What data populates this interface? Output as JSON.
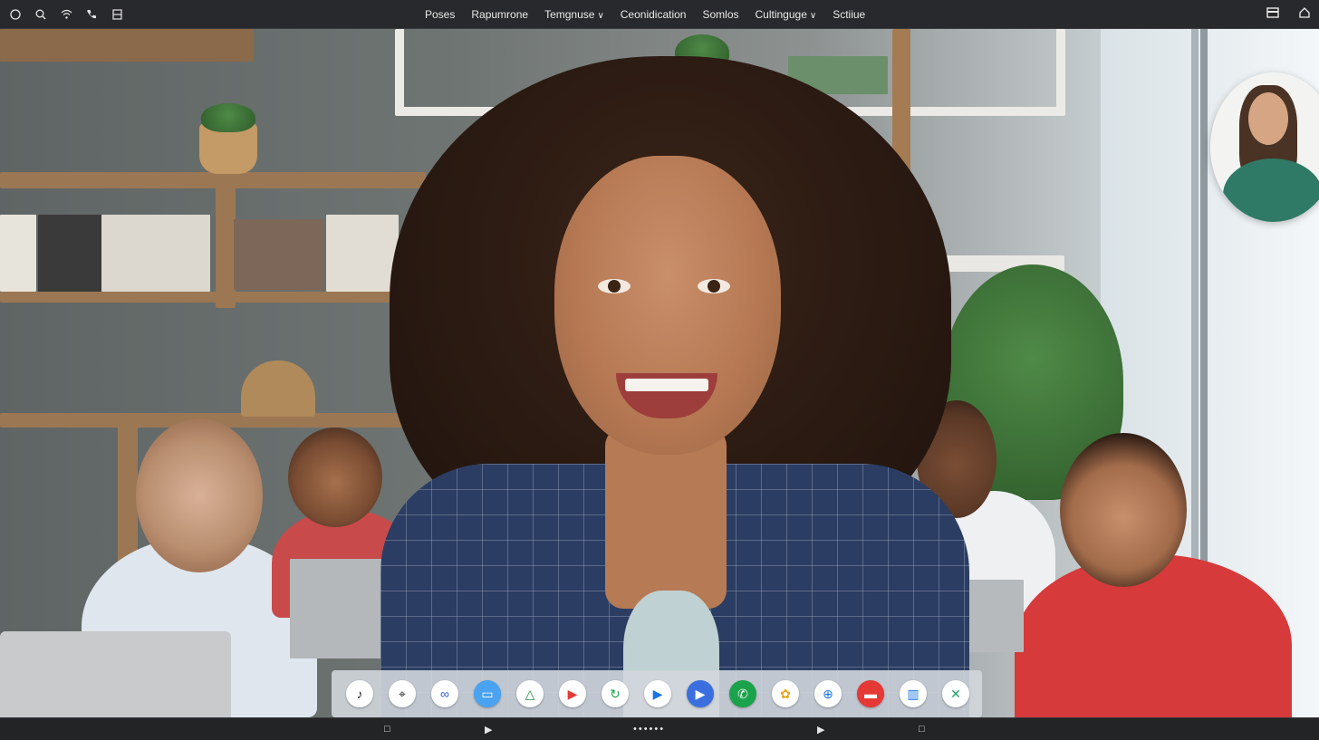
{
  "top_bar": {
    "left_icons": [
      "circle-icon",
      "search-icon",
      "wifi-icon",
      "phone-icon",
      "grid-icon"
    ],
    "menu": [
      {
        "label": "Poses",
        "dropdown": false
      },
      {
        "label": "Rapumrone",
        "dropdown": false
      },
      {
        "label": "Temgnuse",
        "dropdown": true
      },
      {
        "label": "Ceonidication",
        "dropdown": false
      },
      {
        "label": "Somlos",
        "dropdown": false
      },
      {
        "label": "Cultinguge",
        "dropdown": true
      },
      {
        "label": "Sctiiue",
        "dropdown": false
      }
    ],
    "right_icons": [
      "window-icon",
      "home-icon"
    ]
  },
  "dock": {
    "apps": [
      {
        "icon": "music-icon",
        "glyph": "♪",
        "bg": "#ffffff",
        "fg": "#222222"
      },
      {
        "icon": "maps-icon",
        "glyph": "⌖",
        "bg": "#ffffff",
        "fg": "#222222"
      },
      {
        "icon": "meta-icon",
        "glyph": "∞",
        "bg": "#ffffff",
        "fg": "#2a5bd7"
      },
      {
        "icon": "cast-icon",
        "glyph": "▭",
        "bg": "#4aa3f0",
        "fg": "#ffffff"
      },
      {
        "icon": "drive-icon",
        "glyph": "△",
        "bg": "#ffffff",
        "fg": "#1e8e3e"
      },
      {
        "icon": "youtube-icon",
        "glyph": "▶",
        "bg": "#ffffff",
        "fg": "#e53935"
      },
      {
        "icon": "sync-icon",
        "glyph": "↻",
        "bg": "#ffffff",
        "fg": "#1aa34a"
      },
      {
        "icon": "play-store-icon",
        "glyph": "▶",
        "bg": "#ffffff",
        "fg": "#1a73e8"
      },
      {
        "icon": "video-play-icon",
        "glyph": "▶",
        "bg": "#3b6fe0",
        "fg": "#ffffff"
      },
      {
        "icon": "phone-call-icon",
        "glyph": "✆",
        "bg": "#1aa34a",
        "fg": "#ffffff"
      },
      {
        "icon": "photos-icon",
        "glyph": "✿",
        "bg": "#ffffff",
        "fg": "#e8a317"
      },
      {
        "icon": "globe-icon",
        "glyph": "⊕",
        "bg": "#ffffff",
        "fg": "#1a73e8"
      },
      {
        "icon": "messages-icon",
        "glyph": "▬",
        "bg": "#e53935",
        "fg": "#ffffff"
      },
      {
        "icon": "files-icon",
        "glyph": "▥",
        "bg": "#ffffff",
        "fg": "#1a73e8"
      },
      {
        "icon": "tools-icon",
        "glyph": "✕",
        "bg": "#ffffff",
        "fg": "#22a06b"
      }
    ]
  },
  "bottom_bar": {
    "items": [
      {
        "name": "square-icon",
        "glyph": "□"
      },
      {
        "name": "skip-icon",
        "glyph": "⏵|"
      },
      {
        "name": "page-dots",
        "glyph": "••••••"
      },
      {
        "name": "play-icon",
        "glyph": "▶"
      },
      {
        "name": "square-icon-right",
        "glyph": "□"
      }
    ]
  }
}
